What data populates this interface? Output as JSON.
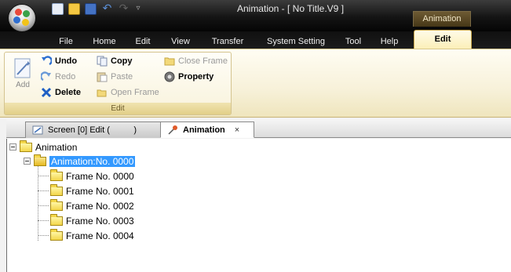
{
  "window": {
    "title": "Animation - [ No Title.V9 ]",
    "context_tab_group": "Animation"
  },
  "quick_access": {
    "icons": [
      "new-file-icon",
      "open-folder-icon",
      "save-icon",
      "undo-icon",
      "redo-icon",
      "customize-icon"
    ]
  },
  "menu_tabs": [
    "File",
    "Home",
    "Edit",
    "View",
    "Transfer",
    "System Setting",
    "Tool",
    "Help",
    "Edit"
  ],
  "active_menu_tab": "Edit",
  "ribbon": {
    "group_label": "Edit",
    "add_label": "Add",
    "undo_label": "Undo",
    "redo_label": "Redo",
    "delete_label": "Delete",
    "copy_label": "Copy",
    "paste_label": "Paste",
    "open_frame_label": "Open Frame",
    "close_frame_label": "Close Frame",
    "property_label": "Property"
  },
  "doc_tabs": {
    "screen_tab": "Screen [0] Edit (          )",
    "animation_tab": "Animation",
    "close_glyph": "×"
  },
  "tree": {
    "root": "Animation",
    "selected": "Animation:No. 0000",
    "frames": [
      "Frame No. 0000",
      "Frame No. 0001",
      "Frame No. 0002",
      "Frame No. 0003",
      "Frame No. 0004"
    ]
  },
  "colors": {
    "selection": "#3399ff",
    "ribbon_bg": "#f7f1d9",
    "titlebar_bg": "#141414"
  }
}
